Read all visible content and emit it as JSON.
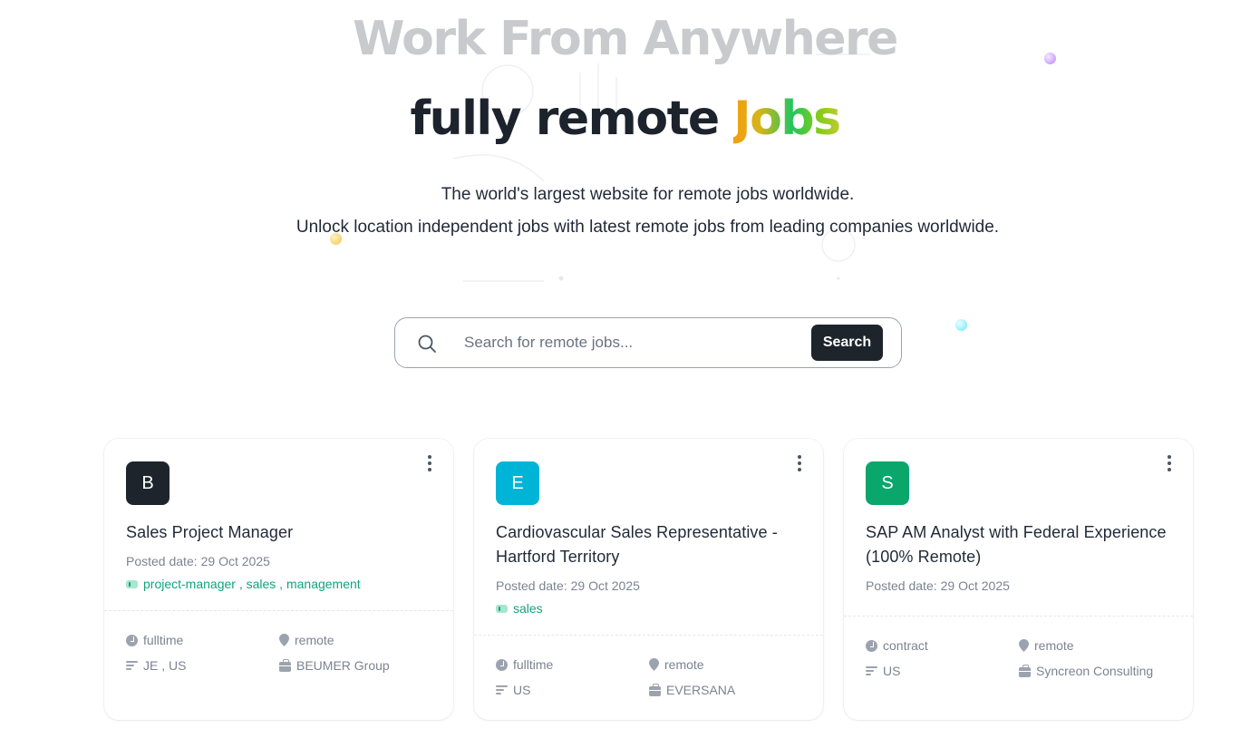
{
  "hero": {
    "kicker": "Work From Anywhere",
    "title_main": "fully remote ",
    "title_accent": "Jobs",
    "subtitle_line1": "The world's largest website for remote jobs worldwide.",
    "subtitle_line2": "Unlock location independent jobs with latest remote jobs from leading companies worldwide."
  },
  "search": {
    "placeholder": "Search for remote jobs...",
    "value": "",
    "button_label": "Search",
    "icon": "search-icon"
  },
  "colors": {
    "primary_dark": "#1e242c",
    "tag_green": "#10a37f",
    "muted_text": "#7b8491",
    "kicker_gray": "#c9cacd"
  },
  "jobs": [
    {
      "logo_letter": "B",
      "logo_color": "#1e242c",
      "title": "Sales Project Manager",
      "posted_label": "Posted date:",
      "posted_date": "29 Oct 2025",
      "tags": "project-manager , sales , management",
      "type": "fulltime",
      "location_type": "remote",
      "countries": "JE , US",
      "company": "BEUMER Group"
    },
    {
      "logo_letter": "E",
      "logo_color": "#00b4d8",
      "title": "Cardiovascular Sales Representative - Hartford Territory",
      "posted_label": "Posted date:",
      "posted_date": "29 Oct 2025",
      "tags": "sales",
      "type": "fulltime",
      "location_type": "remote",
      "countries": "US",
      "company": "EVERSANA"
    },
    {
      "logo_letter": "S",
      "logo_color": "#0ba66b",
      "title": "SAP AM Analyst with Federal Experience (100% Remote)",
      "posted_label": "Posted date:",
      "posted_date": "29 Oct 2025",
      "tags": "",
      "type": "contract",
      "location_type": "remote",
      "countries": "US",
      "company": "Syncreon Consulting"
    }
  ]
}
